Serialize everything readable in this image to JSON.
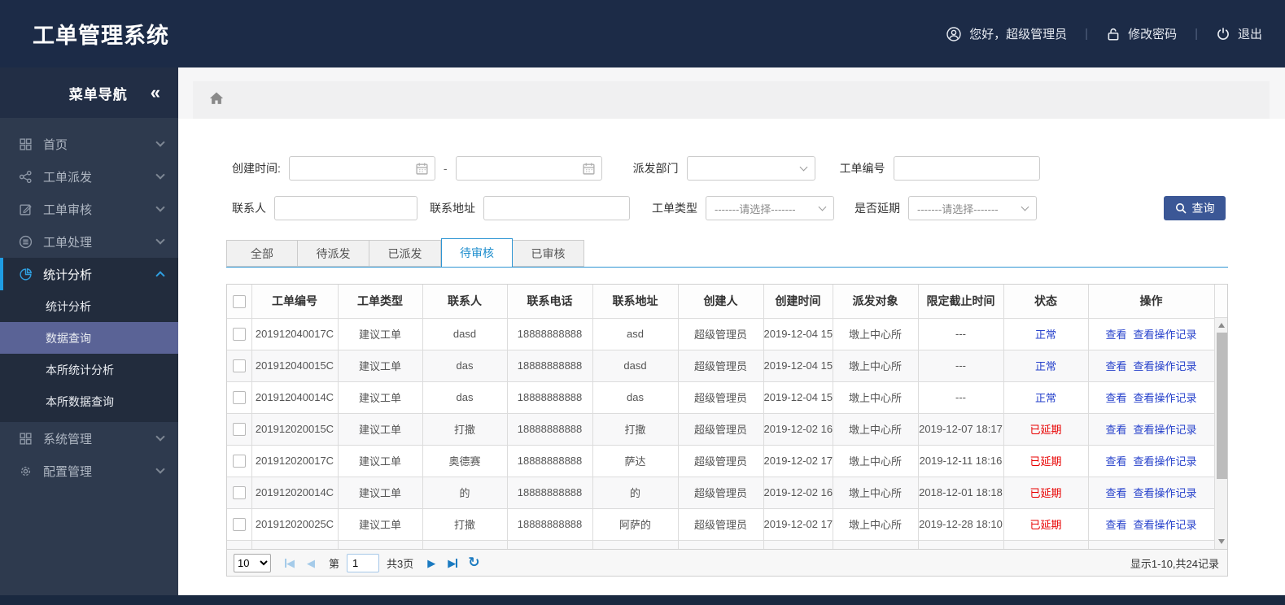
{
  "header": {
    "title": "工单管理系统",
    "greeting": "您好，超级管理员",
    "change_password": "修改密码",
    "logout": "退出",
    "separator": "|"
  },
  "sidebar": {
    "title": "菜单导航",
    "collapse_glyph": "«",
    "items": [
      {
        "label": "首页",
        "icon": "grid-icon",
        "expanded": false,
        "active": false
      },
      {
        "label": "工单派发",
        "icon": "share-icon",
        "expanded": false,
        "active": false
      },
      {
        "label": "工单审核",
        "icon": "edit-icon",
        "expanded": false,
        "active": false
      },
      {
        "label": "工单处理",
        "icon": "stack-icon",
        "expanded": false,
        "active": false
      },
      {
        "label": "统计分析",
        "icon": "pie-icon",
        "expanded": true,
        "active": true,
        "children": [
          {
            "label": "统计分析",
            "active": false
          },
          {
            "label": "数据查询",
            "active": true
          },
          {
            "label": "本所统计分析",
            "active": false
          },
          {
            "label": "本所数据查询",
            "active": false
          }
        ]
      },
      {
        "label": "系统管理",
        "icon": "grid-icon",
        "expanded": false,
        "active": false
      },
      {
        "label": "配置管理",
        "icon": "gear-icon",
        "expanded": false,
        "active": false
      }
    ]
  },
  "filters": {
    "created_time_label": "创建时间:",
    "date_separator": "-",
    "dispatch_dept_label": "派发部门",
    "order_no_label": "工单编号",
    "contact_label": "联系人",
    "address_label": "联系地址",
    "order_type_label": "工单类型",
    "order_type_value": "-------请选择-------",
    "delay_label": "是否延期",
    "delay_value": "-------请选择-------",
    "search_button": "查询"
  },
  "tabs": [
    {
      "label": "全部",
      "active": false
    },
    {
      "label": "待派发",
      "active": false
    },
    {
      "label": "已派发",
      "active": false
    },
    {
      "label": "待审核",
      "active": true
    },
    {
      "label": "已审核",
      "active": false
    }
  ],
  "table": {
    "columns": [
      "工单编号",
      "工单类型",
      "联系人",
      "联系电话",
      "联系地址",
      "创建人",
      "创建时间",
      "派发对象",
      "限定截止时间",
      "状态",
      "操作"
    ],
    "status_normal": "正常",
    "status_delayed": "已延期",
    "op_view": "查看",
    "op_log": "查看操作记录",
    "rows": [
      {
        "order_no": "201912040017C",
        "type": "建议工单",
        "contact": "dasd",
        "phone": "18888888888",
        "address": "asd",
        "creator": "超级管理员",
        "created": "2019-12-04 15",
        "target": "墩上中心所",
        "deadline": "---",
        "status": "正常"
      },
      {
        "order_no": "201912040015C",
        "type": "建议工单",
        "contact": "das",
        "phone": "18888888888",
        "address": "dasd",
        "creator": "超级管理员",
        "created": "2019-12-04 15",
        "target": "墩上中心所",
        "deadline": "---",
        "status": "正常"
      },
      {
        "order_no": "201912040014C",
        "type": "建议工单",
        "contact": "das",
        "phone": "18888888888",
        "address": "das",
        "creator": "超级管理员",
        "created": "2019-12-04 15",
        "target": "墩上中心所",
        "deadline": "---",
        "status": "正常"
      },
      {
        "order_no": "201912020015C",
        "type": "建议工单",
        "contact": "打撒",
        "phone": "18888888888",
        "address": "打撒",
        "creator": "超级管理员",
        "created": "2019-12-02 16",
        "target": "墩上中心所",
        "deadline": "2019-12-07 18:17",
        "status": "已延期"
      },
      {
        "order_no": "201912020017C",
        "type": "建议工单",
        "contact": "奥德赛",
        "phone": "18888888888",
        "address": "萨达",
        "creator": "超级管理员",
        "created": "2019-12-02 17",
        "target": "墩上中心所",
        "deadline": "2019-12-11 18:16",
        "status": "已延期"
      },
      {
        "order_no": "201912020014C",
        "type": "建议工单",
        "contact": "的",
        "phone": "18888888888",
        "address": "的",
        "creator": "超级管理员",
        "created": "2019-12-02 16",
        "target": "墩上中心所",
        "deadline": "2018-12-01 18:18",
        "status": "已延期"
      },
      {
        "order_no": "201912020025C",
        "type": "建议工单",
        "contact": "打撒",
        "phone": "18888888888",
        "address": "阿萨的",
        "creator": "超级管理员",
        "created": "2019-12-02 17",
        "target": "墩上中心所",
        "deadline": "2019-12-28 18:10",
        "status": "已延期"
      }
    ]
  },
  "pagination": {
    "page_size": "10",
    "page_prefix": "第",
    "page_value": "1",
    "total_pages": "共3页",
    "summary": "显示1-10,共24记录"
  },
  "colors": {
    "header_bg": "#1c2b47",
    "sidebar_bg": "#2e3a4e",
    "accent_blue": "#2f9fe0",
    "active_submenu": "#5a6396",
    "tab_active": "#2e95d3",
    "search_button": "#3b5796",
    "link_blue": "#2540cb",
    "status_delayed_red": "#e80000"
  }
}
